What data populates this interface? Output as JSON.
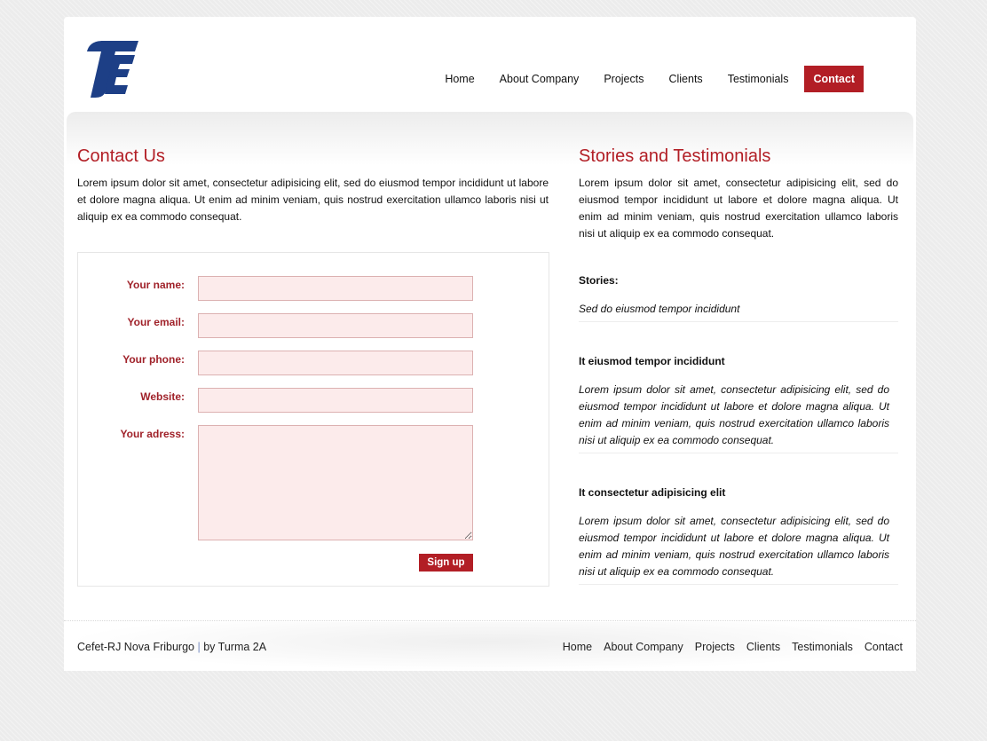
{
  "nav": {
    "items": [
      "Home",
      "About Company",
      "Projects",
      "Clients",
      "Testimonials"
    ],
    "active": "Contact"
  },
  "contact": {
    "title": "Contact Us",
    "intro": "Lorem ipsum dolor sit amet, consectetur adipisicing elit, sed do eiusmod tempor incididunt ut labore et dolore magna aliqua. Ut enim ad minim veniam, quis nostrud exercitation ullamco laboris nisi ut aliquip ex ea commodo consequat.",
    "form": {
      "name_label": "Your name:",
      "email_label": "Your email:",
      "phone_label": "Your phone:",
      "website_label": "Website:",
      "address_label": "Your adress:",
      "name_value": "",
      "email_value": "",
      "phone_value": "",
      "website_value": "",
      "address_value": "",
      "submit_label": "Sign up"
    }
  },
  "testimonials": {
    "title": "Stories and Testimonials",
    "intro": "Lorem ipsum dolor sit amet, consectetur adipisicing elit, sed do eiusmod tempor incididunt ut labore et dolore magna aliqua. Ut enim ad minim veniam, quis nostrud exercitation ullamco laboris nisi ut aliquip ex ea commodo consequat.",
    "stories": [
      {
        "heading": "Stories:",
        "text": "Sed do eiusmod tempor incididunt"
      },
      {
        "heading": "It eiusmod tempor incididunt",
        "text": "Lorem ipsum dolor sit amet, consectetur adipisicing elit, sed do eiusmod tempor incididunt ut labore et dolore magna aliqua. Ut enim ad minim veniam, quis nostrud exercitation ullamco laboris nisi ut aliquip ex ea commodo consequat."
      },
      {
        "heading": "It consectetur adipisicing elit",
        "text": "Lorem ipsum dolor sit amet, consectetur adipisicing elit, sed do eiusmod tempor incididunt ut labore et dolore magna aliqua. Ut enim ad minim veniam, quis nostrud exercitation ullamco laboris nisi ut aliquip ex ea commodo consequat."
      }
    ]
  },
  "footer": {
    "credit_site": "Cefet-RJ Nova Friburgo",
    "credit_sep": "|",
    "credit_by": "by Turma 2A",
    "links": [
      "Home",
      "About Company",
      "Projects",
      "Clients",
      "Testimonials",
      "Contact"
    ]
  },
  "colors": {
    "accent": "#b21e25",
    "logo": "#1d3f86",
    "field_bg": "#fcebeb"
  },
  "icons": {
    "logo": "te-monogram-logo"
  }
}
